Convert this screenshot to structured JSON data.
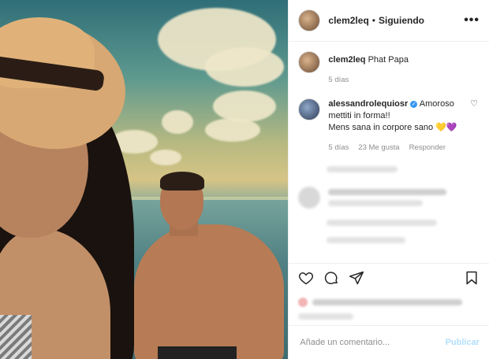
{
  "header": {
    "username": "clem2leq",
    "separator": "•",
    "follow_status": "Siguiendo",
    "more_icon": "ellipsis-icon"
  },
  "caption": {
    "username": "clem2leq",
    "text": "Phat Papa",
    "time": "5 días"
  },
  "comment": {
    "username": "alessandrolequiosr",
    "verified": true,
    "text_line1": "Amoroso",
    "text_line2": "mettiti in forma!!",
    "text_line3": "Mens sana in corpore sano",
    "emojis": "💛💜",
    "time": "5 días",
    "likes": "23 Me gusta",
    "reply": "Responder"
  },
  "actions": {
    "like_icon": "heart-icon",
    "comment_icon": "comment-icon",
    "share_icon": "send-icon",
    "save_icon": "bookmark-icon"
  },
  "composer": {
    "placeholder": "Añade un comentario...",
    "publish_label": "Publicar"
  },
  "colors": {
    "accent": "#3897f0",
    "publish_disabled": "#b2dffc",
    "muted": "#8e8e8e"
  }
}
